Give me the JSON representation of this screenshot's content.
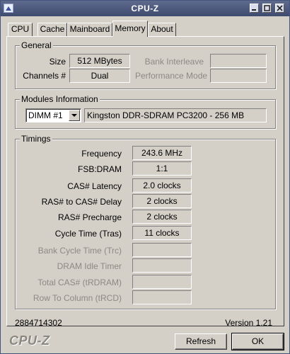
{
  "window": {
    "title": "CPU-Z"
  },
  "tabs": [
    {
      "label": "CPU",
      "active": false
    },
    {
      "label": "Cache",
      "active": false
    },
    {
      "label": "Mainboard",
      "active": false
    },
    {
      "label": "Memory",
      "active": true
    },
    {
      "label": "About",
      "active": false
    }
  ],
  "general": {
    "legend": "General",
    "size_label": "Size",
    "size_value": "512 MBytes",
    "channels_label": "Channels #",
    "channels_value": "Dual",
    "bank_interleave_label": "Bank Interleave",
    "bank_interleave_value": "",
    "performance_mode_label": "Performance Mode",
    "performance_mode_value": ""
  },
  "modules": {
    "legend": "Modules Information",
    "selected_slot": "DIMM #1",
    "module_description": "Kingston DDR-SDRAM PC3200 - 256 MB"
  },
  "timings": {
    "legend": "Timings",
    "rows": [
      {
        "label": "Frequency",
        "value": "243.6 MHz",
        "enabled": true
      },
      {
        "label": "FSB:DRAM",
        "value": "1:1",
        "enabled": true
      },
      {
        "label": "CAS# Latency",
        "value": "2.0 clocks",
        "enabled": true
      },
      {
        "label": "RAS# to CAS# Delay",
        "value": "2 clocks",
        "enabled": true
      },
      {
        "label": "RAS# Precharge",
        "value": "2 clocks",
        "enabled": true
      },
      {
        "label": "Cycle Time (Tras)",
        "value": "11 clocks",
        "enabled": true
      },
      {
        "label": "Bank Cycle Time (Trc)",
        "value": "",
        "enabled": false
      },
      {
        "label": "DRAM Idle Timer",
        "value": "",
        "enabled": false
      },
      {
        "label": "Total CAS# (tRDRAM)",
        "value": "",
        "enabled": false
      },
      {
        "label": "Row To Column (tRCD)",
        "value": "",
        "enabled": false
      }
    ]
  },
  "status": {
    "id_number": "2884714302",
    "version": "Version 1.21"
  },
  "footer": {
    "brand": "CPU-Z",
    "refresh_label": "Refresh",
    "ok_label": "OK"
  },
  "colors": {
    "titlebar": "#4a5678",
    "face": "#d4d0c8",
    "disabled_text": "#8c8a85"
  }
}
